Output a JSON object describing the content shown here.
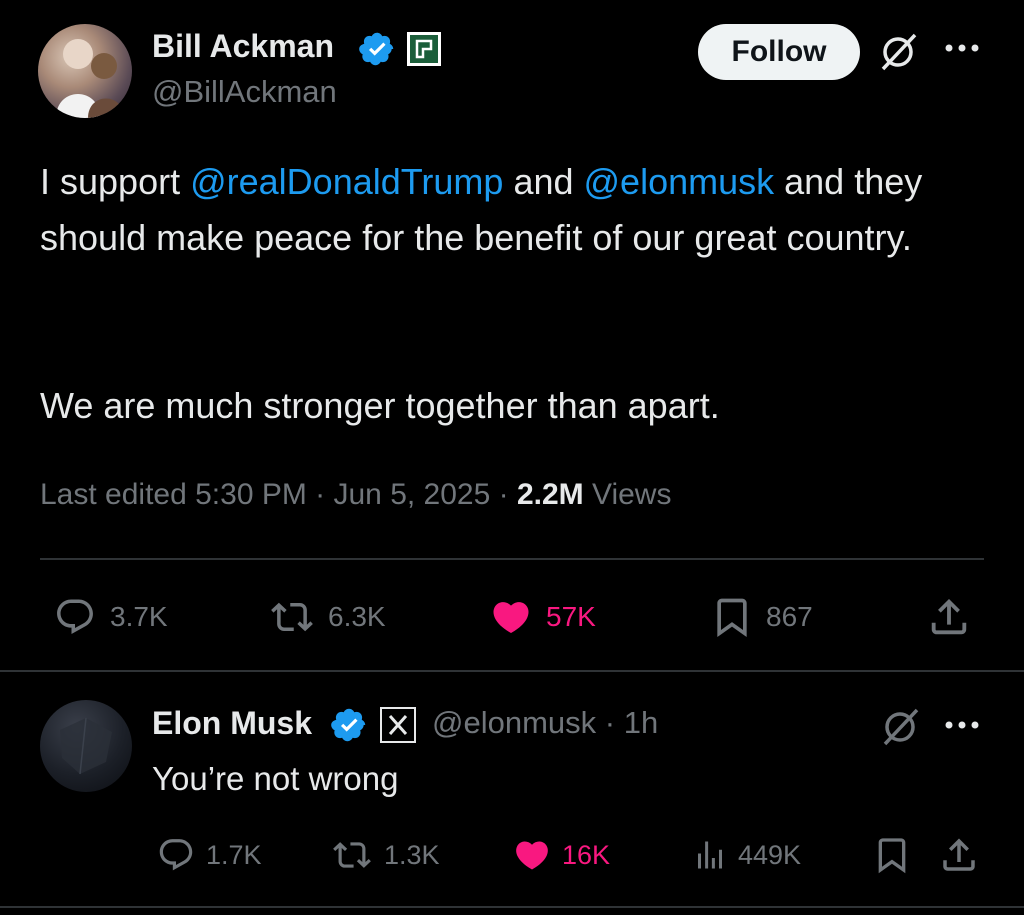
{
  "main_post": {
    "author_name": "Bill Ackman",
    "author_handle": "@BillAckman",
    "follow_label": "Follow",
    "text_parts": {
      "p1": "I support ",
      "mention1": "@realDonaldTrump",
      "p2": " and ",
      "mention2": "@elonmusk",
      "p3": " and they should make peace for the benefit of our great country.",
      "para2": "We are much stronger together than apart."
    },
    "meta": {
      "edited": "Last edited 5:30 PM · Jun 5, 2025 · ",
      "views_count": "2.2M",
      "views_label": " Views"
    },
    "stats": {
      "replies": "3.7K",
      "reposts": "6.3K",
      "likes": "57K",
      "bookmarks": "867"
    }
  },
  "reply": {
    "author_name": "Elon Musk",
    "author_handle": "@elonmusk",
    "time": " · 1h",
    "text": "You’re not wrong",
    "stats": {
      "replies": "1.7K",
      "reposts": "1.3K",
      "likes": "16K",
      "views": "449K"
    }
  },
  "colors": {
    "accent": "#1d9bf0",
    "like": "#f91880",
    "muted": "#71767b",
    "text": "#e7e9ea",
    "background": "#000000"
  },
  "icons": [
    "verified-badge-icon",
    "affiliate-badge-icon",
    "x-logo-icon",
    "grok-icon",
    "more-icon",
    "reply-icon",
    "repost-icon",
    "heart-icon",
    "bookmark-icon",
    "share-icon",
    "views-icon"
  ]
}
